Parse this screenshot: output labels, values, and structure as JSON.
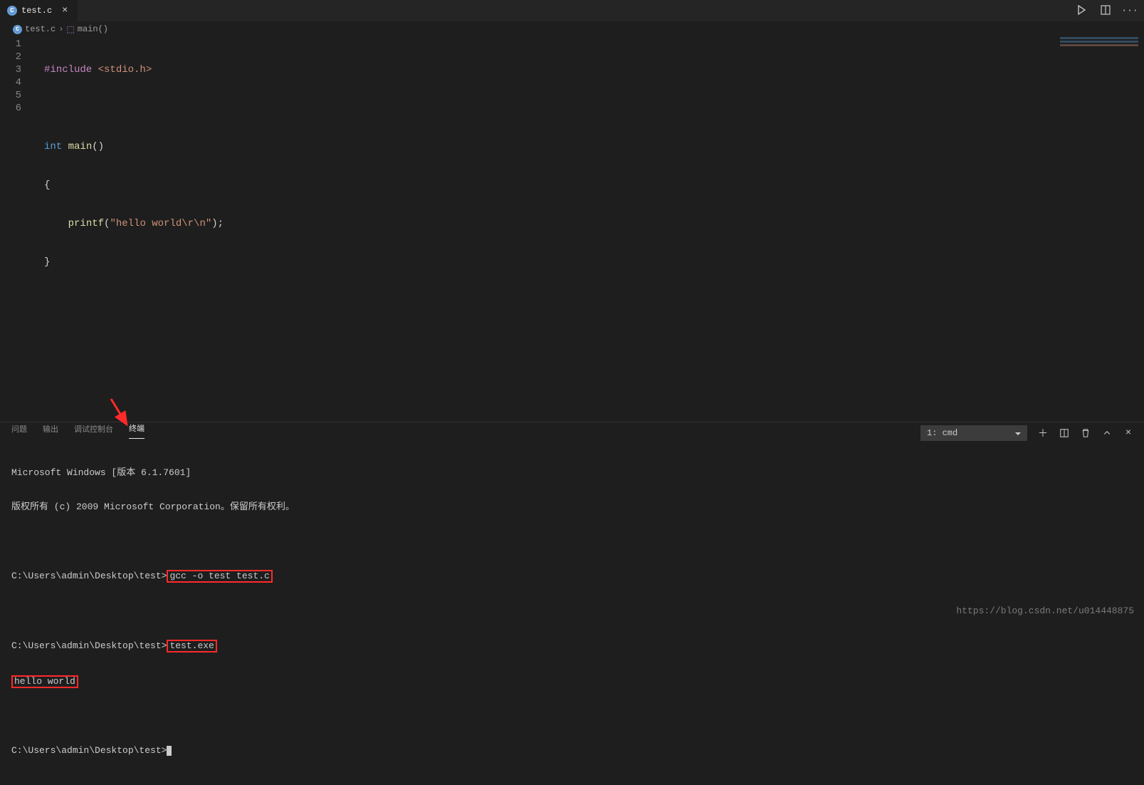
{
  "tab": {
    "filename": "test.c"
  },
  "breadcrumbs": {
    "file": "test.c",
    "symbol": "main()"
  },
  "code": {
    "lines": [
      {
        "n": "1",
        "kw": "#include",
        "rest": " <stdio.h>"
      },
      {
        "n": "2",
        "raw": ""
      },
      {
        "n": "3",
        "kw": "int",
        "fn": " main",
        "pn": "()"
      },
      {
        "n": "4",
        "raw": "{"
      },
      {
        "n": "5",
        "indent": "    ",
        "fn": "printf",
        "pn1": "(",
        "str": "\"hello world\\r\\n\"",
        "pn2": ");"
      },
      {
        "n": "6",
        "raw": "}"
      }
    ]
  },
  "panel": {
    "tabs": {
      "problems": "问题",
      "output": "输出",
      "debug": "调试控制台",
      "terminal": "终端"
    },
    "selector": "1: cmd"
  },
  "terminal": {
    "l1": "Microsoft Windows [版本 6.1.7601]",
    "l2": "版权所有 (c) 2009 Microsoft Corporation。保留所有权利。",
    "prompt": "C:\\Users\\admin\\Desktop\\test>",
    "cmd1": "gcc -o test test.c",
    "cmd2": "test.exe",
    "out1": "hello world"
  },
  "watermark": "https://blog.csdn.net/u014448875"
}
